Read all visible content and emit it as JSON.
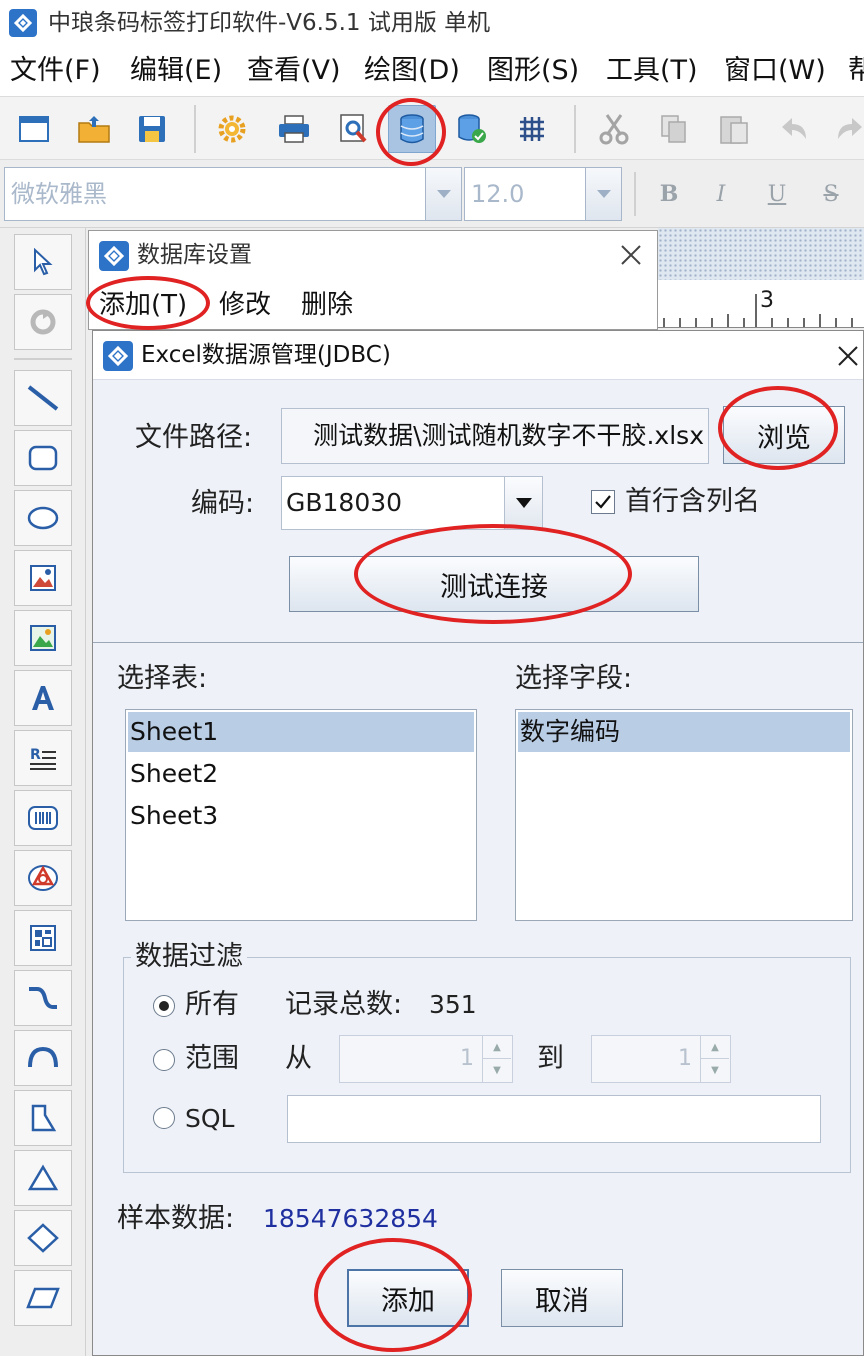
{
  "app": {
    "title": "中琅条码标签打印软件-V6.5.1 试用版 单机"
  },
  "menubar": {
    "items": [
      "文件(F)",
      "编辑(E)",
      "查看(V)",
      "绘图(D)",
      "图形(S)",
      "工具(T)",
      "窗口(W)",
      "帮"
    ]
  },
  "toolbar": {
    "buttons": [
      "new-icon",
      "open-icon",
      "save-icon",
      "settings-gear-icon",
      "print-icon",
      "print-preview-icon",
      "database-icon",
      "database-connect-icon",
      "grid-icon",
      "cut-icon",
      "copy-icon",
      "paste-icon",
      "undo-icon",
      "redo-icon"
    ],
    "active": "database-icon"
  },
  "fontbar": {
    "font_name": "微软雅黑",
    "font_size": "12.0",
    "bold": "B",
    "italic": "I",
    "underline": "U",
    "strike": "S"
  },
  "ruler": {
    "mark": "3"
  },
  "db_window": {
    "title": "数据库设置",
    "menu": {
      "add": "添加(T)",
      "edit": "修改",
      "delete": "删除"
    }
  },
  "excel_dialog": {
    "title": "Excel数据源管理(JDBC)",
    "file_path_label": "文件路径:",
    "file_path_value": "测试数据\\测试随机数字不干胶.xlsx",
    "browse_label": "浏览",
    "encoding_label": "编码:",
    "encoding_value": "GB18030",
    "header_row_label": "首行含列名",
    "header_row_checked": true,
    "test_connection_label": "测试连接",
    "select_table_label": "选择表:",
    "tables": [
      "Sheet1",
      "Sheet2",
      "Sheet3"
    ],
    "selected_table": "Sheet1",
    "select_field_label": "选择字段:",
    "fields": [
      "数字编码"
    ],
    "filter": {
      "legend": "数据过滤",
      "all_label": "所有",
      "total_label": "记录总数:",
      "total_value": "351",
      "range_label": "范围",
      "from_label": "从",
      "from_value": "1",
      "to_label": "到",
      "to_value": "1",
      "sql_label": "SQL",
      "sql_value": "",
      "selected": "all"
    },
    "sample_label": "样本数据:",
    "sample_value": "18547632854",
    "add_label": "添加",
    "cancel_label": "取消"
  },
  "colors": {
    "annotation": "#e02222",
    "selection": "#b9cde5",
    "dialog_bg": "#eef2f8",
    "sample_value": "#1f2fa0"
  }
}
